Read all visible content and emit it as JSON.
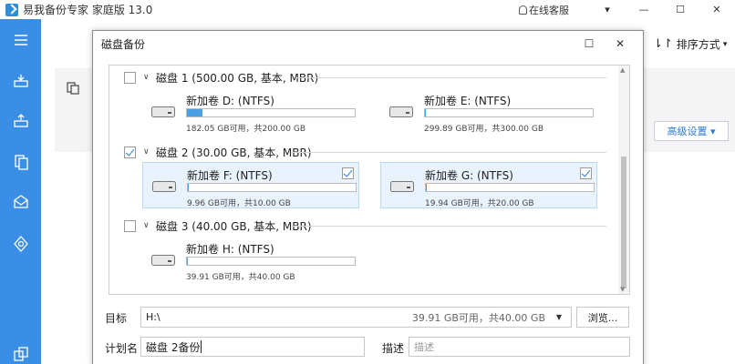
{
  "app": {
    "title": "易我备份专家 家庭版 13.0",
    "support_label": "在线客服",
    "dropdown_glyph": "▾",
    "minimize_glyph": "—",
    "maximize_glyph": "☐",
    "close_glyph": "✕"
  },
  "toolbar": {
    "sort_label": "排序方式",
    "sort_glyph": "⇂↾",
    "sort_chevron": "▾",
    "advanced_label": "高级设置 ▾"
  },
  "dialog": {
    "title": "磁盘备份",
    "maximize_glyph": "☐",
    "close_glyph": "✕"
  },
  "disks": [
    {
      "title": "磁盘 1 (500.00 GB, 基本, MBR)",
      "checked": false,
      "partitions": [
        {
          "name": "新加卷 D: (NTFS)",
          "size": "182.05 GB可用，共200.00 GB",
          "used_fraction": 0.09,
          "checked": false,
          "selected": false
        },
        {
          "name": "新加卷 E: (NTFS)",
          "size": "299.89 GB可用，共300.00 GB",
          "used_fraction": 0.0,
          "checked": false,
          "selected": false
        }
      ]
    },
    {
      "title": "磁盘 2 (30.00 GB, 基本, MBR)",
      "checked": true,
      "partitions": [
        {
          "name": "新加卷 F: (NTFS)",
          "size": "9.96 GB可用，共10.00 GB",
          "used_fraction": 0.004,
          "checked": true,
          "selected": true
        },
        {
          "name": "新加卷 G: (NTFS)",
          "size": "19.94 GB可用，共20.00 GB",
          "used_fraction": 0.003,
          "checked": true,
          "selected": true
        }
      ]
    },
    {
      "title": "磁盘 3 (40.00 GB, 基本, MBR)",
      "checked": false,
      "partitions": [
        {
          "name": "新加卷 H: (NTFS)",
          "size": "39.91 GB可用，共40.00 GB",
          "used_fraction": 0.002,
          "checked": false,
          "selected": false
        }
      ]
    }
  ],
  "chevron_glyph": "∨",
  "scroll_up": "▲",
  "scroll_down": "▼",
  "form": {
    "target_label": "目标",
    "target_value": "H:\\",
    "target_space": "39.91 GB可用，共40.00 GB",
    "target_arrow": "▼",
    "browse_label": "浏览...",
    "plan_label": "计划名",
    "plan_value": "磁盘 2备份",
    "desc_label": "描述",
    "desc_placeholder": "描述"
  },
  "colors": {
    "sidebar": "#3a8ee6",
    "accent": "#2a7ad4",
    "selection": "#e9f3fd"
  },
  "icons": [
    "app-logo-icon",
    "headset-icon",
    "menu-icon",
    "backup-icon",
    "restore-icon",
    "clone-icon",
    "mail-icon",
    "settings-icon",
    "copy-icon",
    "drive-icon"
  ]
}
